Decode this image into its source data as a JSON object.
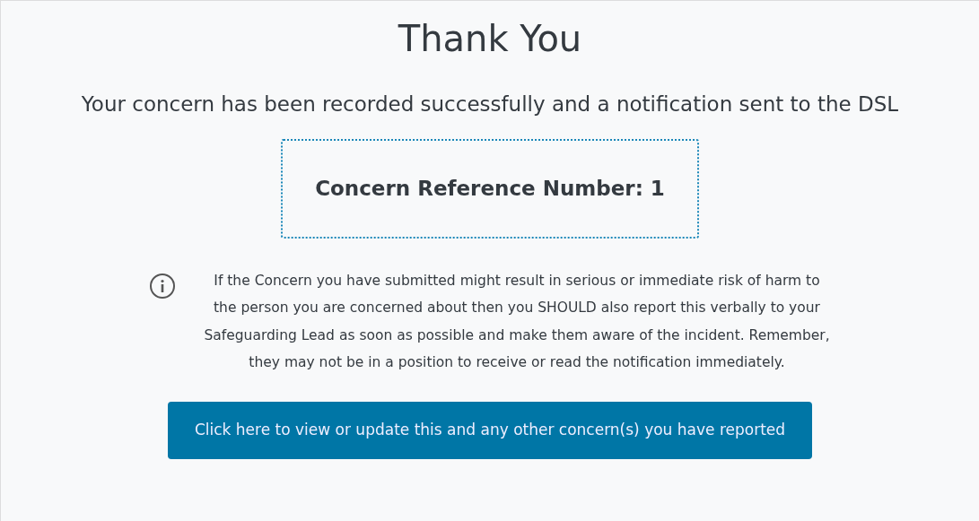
{
  "title": "Thank You",
  "message": "Your concern has been recorded successfully and a notification sent to the DSL",
  "reference": "Concern Reference Number: 1",
  "notice": "If the Concern you have submitted might result in serious or immediate risk of harm to the person you are concerned about then you SHOULD also report this verbally to your Safeguarding Lead as soon as possible and make them aware of the incident. Remember, they may not be in a position to receive or read the notification immediately.",
  "button": "Click here to view or update this and any other concern(s) you have reported"
}
